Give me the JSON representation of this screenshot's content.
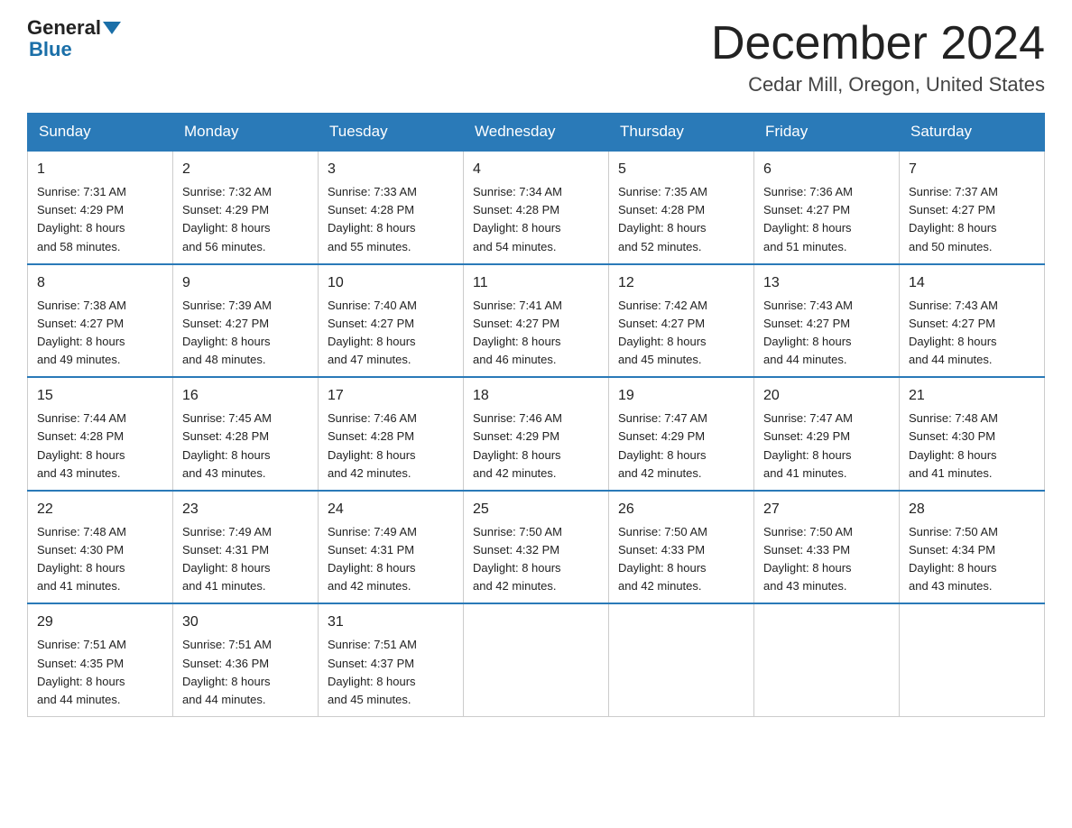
{
  "header": {
    "logo": {
      "general": "General",
      "blue": "Blue"
    },
    "title": "December 2024",
    "location": "Cedar Mill, Oregon, United States"
  },
  "calendar": {
    "days_of_week": [
      "Sunday",
      "Monday",
      "Tuesday",
      "Wednesday",
      "Thursday",
      "Friday",
      "Saturday"
    ],
    "weeks": [
      [
        {
          "day": "1",
          "sunrise": "Sunrise: 7:31 AM",
          "sunset": "Sunset: 4:29 PM",
          "daylight": "Daylight: 8 hours",
          "daylight2": "and 58 minutes."
        },
        {
          "day": "2",
          "sunrise": "Sunrise: 7:32 AM",
          "sunset": "Sunset: 4:29 PM",
          "daylight": "Daylight: 8 hours",
          "daylight2": "and 56 minutes."
        },
        {
          "day": "3",
          "sunrise": "Sunrise: 7:33 AM",
          "sunset": "Sunset: 4:28 PM",
          "daylight": "Daylight: 8 hours",
          "daylight2": "and 55 minutes."
        },
        {
          "day": "4",
          "sunrise": "Sunrise: 7:34 AM",
          "sunset": "Sunset: 4:28 PM",
          "daylight": "Daylight: 8 hours",
          "daylight2": "and 54 minutes."
        },
        {
          "day": "5",
          "sunrise": "Sunrise: 7:35 AM",
          "sunset": "Sunset: 4:28 PM",
          "daylight": "Daylight: 8 hours",
          "daylight2": "and 52 minutes."
        },
        {
          "day": "6",
          "sunrise": "Sunrise: 7:36 AM",
          "sunset": "Sunset: 4:27 PM",
          "daylight": "Daylight: 8 hours",
          "daylight2": "and 51 minutes."
        },
        {
          "day": "7",
          "sunrise": "Sunrise: 7:37 AM",
          "sunset": "Sunset: 4:27 PM",
          "daylight": "Daylight: 8 hours",
          "daylight2": "and 50 minutes."
        }
      ],
      [
        {
          "day": "8",
          "sunrise": "Sunrise: 7:38 AM",
          "sunset": "Sunset: 4:27 PM",
          "daylight": "Daylight: 8 hours",
          "daylight2": "and 49 minutes."
        },
        {
          "day": "9",
          "sunrise": "Sunrise: 7:39 AM",
          "sunset": "Sunset: 4:27 PM",
          "daylight": "Daylight: 8 hours",
          "daylight2": "and 48 minutes."
        },
        {
          "day": "10",
          "sunrise": "Sunrise: 7:40 AM",
          "sunset": "Sunset: 4:27 PM",
          "daylight": "Daylight: 8 hours",
          "daylight2": "and 47 minutes."
        },
        {
          "day": "11",
          "sunrise": "Sunrise: 7:41 AM",
          "sunset": "Sunset: 4:27 PM",
          "daylight": "Daylight: 8 hours",
          "daylight2": "and 46 minutes."
        },
        {
          "day": "12",
          "sunrise": "Sunrise: 7:42 AM",
          "sunset": "Sunset: 4:27 PM",
          "daylight": "Daylight: 8 hours",
          "daylight2": "and 45 minutes."
        },
        {
          "day": "13",
          "sunrise": "Sunrise: 7:43 AM",
          "sunset": "Sunset: 4:27 PM",
          "daylight": "Daylight: 8 hours",
          "daylight2": "and 44 minutes."
        },
        {
          "day": "14",
          "sunrise": "Sunrise: 7:43 AM",
          "sunset": "Sunset: 4:27 PM",
          "daylight": "Daylight: 8 hours",
          "daylight2": "and 44 minutes."
        }
      ],
      [
        {
          "day": "15",
          "sunrise": "Sunrise: 7:44 AM",
          "sunset": "Sunset: 4:28 PM",
          "daylight": "Daylight: 8 hours",
          "daylight2": "and 43 minutes."
        },
        {
          "day": "16",
          "sunrise": "Sunrise: 7:45 AM",
          "sunset": "Sunset: 4:28 PM",
          "daylight": "Daylight: 8 hours",
          "daylight2": "and 43 minutes."
        },
        {
          "day": "17",
          "sunrise": "Sunrise: 7:46 AM",
          "sunset": "Sunset: 4:28 PM",
          "daylight": "Daylight: 8 hours",
          "daylight2": "and 42 minutes."
        },
        {
          "day": "18",
          "sunrise": "Sunrise: 7:46 AM",
          "sunset": "Sunset: 4:29 PM",
          "daylight": "Daylight: 8 hours",
          "daylight2": "and 42 minutes."
        },
        {
          "day": "19",
          "sunrise": "Sunrise: 7:47 AM",
          "sunset": "Sunset: 4:29 PM",
          "daylight": "Daylight: 8 hours",
          "daylight2": "and 42 minutes."
        },
        {
          "day": "20",
          "sunrise": "Sunrise: 7:47 AM",
          "sunset": "Sunset: 4:29 PM",
          "daylight": "Daylight: 8 hours",
          "daylight2": "and 41 minutes."
        },
        {
          "day": "21",
          "sunrise": "Sunrise: 7:48 AM",
          "sunset": "Sunset: 4:30 PM",
          "daylight": "Daylight: 8 hours",
          "daylight2": "and 41 minutes."
        }
      ],
      [
        {
          "day": "22",
          "sunrise": "Sunrise: 7:48 AM",
          "sunset": "Sunset: 4:30 PM",
          "daylight": "Daylight: 8 hours",
          "daylight2": "and 41 minutes."
        },
        {
          "day": "23",
          "sunrise": "Sunrise: 7:49 AM",
          "sunset": "Sunset: 4:31 PM",
          "daylight": "Daylight: 8 hours",
          "daylight2": "and 41 minutes."
        },
        {
          "day": "24",
          "sunrise": "Sunrise: 7:49 AM",
          "sunset": "Sunset: 4:31 PM",
          "daylight": "Daylight: 8 hours",
          "daylight2": "and 42 minutes."
        },
        {
          "day": "25",
          "sunrise": "Sunrise: 7:50 AM",
          "sunset": "Sunset: 4:32 PM",
          "daylight": "Daylight: 8 hours",
          "daylight2": "and 42 minutes."
        },
        {
          "day": "26",
          "sunrise": "Sunrise: 7:50 AM",
          "sunset": "Sunset: 4:33 PM",
          "daylight": "Daylight: 8 hours",
          "daylight2": "and 42 minutes."
        },
        {
          "day": "27",
          "sunrise": "Sunrise: 7:50 AM",
          "sunset": "Sunset: 4:33 PM",
          "daylight": "Daylight: 8 hours",
          "daylight2": "and 43 minutes."
        },
        {
          "day": "28",
          "sunrise": "Sunrise: 7:50 AM",
          "sunset": "Sunset: 4:34 PM",
          "daylight": "Daylight: 8 hours",
          "daylight2": "and 43 minutes."
        }
      ],
      [
        {
          "day": "29",
          "sunrise": "Sunrise: 7:51 AM",
          "sunset": "Sunset: 4:35 PM",
          "daylight": "Daylight: 8 hours",
          "daylight2": "and 44 minutes."
        },
        {
          "day": "30",
          "sunrise": "Sunrise: 7:51 AM",
          "sunset": "Sunset: 4:36 PM",
          "daylight": "Daylight: 8 hours",
          "daylight2": "and 44 minutes."
        },
        {
          "day": "31",
          "sunrise": "Sunrise: 7:51 AM",
          "sunset": "Sunset: 4:37 PM",
          "daylight": "Daylight: 8 hours",
          "daylight2": "and 45 minutes."
        },
        null,
        null,
        null,
        null
      ]
    ]
  }
}
